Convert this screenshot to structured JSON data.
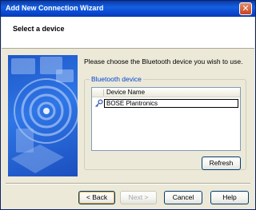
{
  "window": {
    "title": "Add New Connection Wizard",
    "close_glyph": "✕"
  },
  "header": {
    "heading": "Select a device"
  },
  "banner": {
    "icon": "bluetooth-wizard-illustration-icon"
  },
  "main": {
    "instruction": "Please choose the Bluetooth device you wish to use.",
    "group_label": "Bluetooth device",
    "column_header": "Device Name",
    "devices": [
      {
        "name": "BOSE Plantronics",
        "icon": "key-icon",
        "selected": true
      }
    ],
    "refresh_label": "Refresh"
  },
  "footer": {
    "back_label": "< Back",
    "next_label": "Next >",
    "cancel_label": "Cancel",
    "help_label": "Help"
  },
  "colors": {
    "titlebar": "#1560e0",
    "group_label": "#0046d5",
    "dialog_bg": "#ece9d8"
  }
}
